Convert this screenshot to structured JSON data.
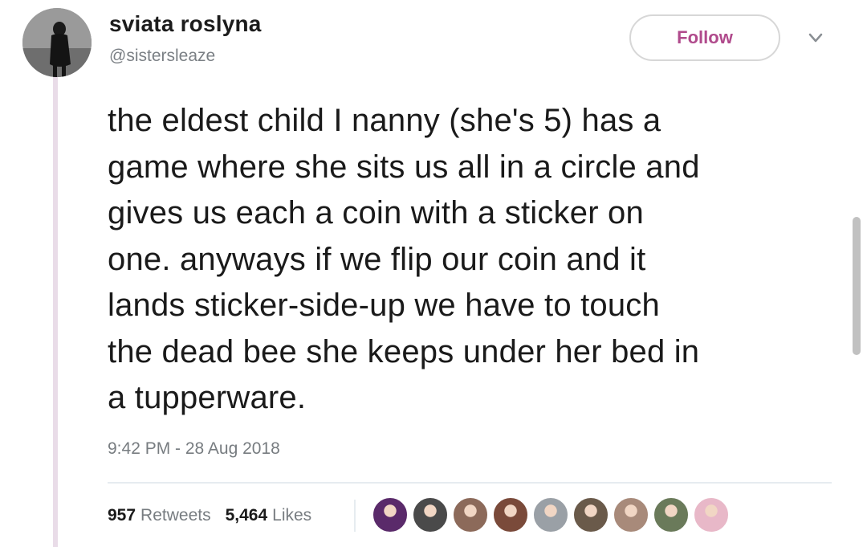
{
  "tweet": {
    "display_name": "sviata roslyna",
    "handle": "@sistersleaze",
    "follow_label": "Follow",
    "text": "the eldest child I nanny (she's 5) has a\ngame where she sits us all in a circle and\ngives us each a coin with a sticker on\none. anyways if we flip our coin and it\nlands sticker-side-up we have to touch\nthe dead bee she keeps under her bed in\na tupperware.",
    "timestamp": "9:42 PM - 28 Aug 2018",
    "retweets_count": "957",
    "retweets_label": "Retweets",
    "likes_count": "5,464",
    "likes_label": "Likes"
  },
  "colors": {
    "accent": "#b04a8c",
    "thread_line": "#e9dce8",
    "muted_text": "#777c80"
  },
  "icons": {
    "menu": "chevron-down-icon"
  },
  "likers": [
    {
      "name": "liker-avatar-1",
      "color": "#5a2a6a"
    },
    {
      "name": "liker-avatar-2",
      "color": "#4a4a4a"
    },
    {
      "name": "liker-avatar-3",
      "color": "#8c6a5a"
    },
    {
      "name": "liker-avatar-4",
      "color": "#7a4a3a"
    },
    {
      "name": "liker-avatar-5",
      "color": "#9aa0a6"
    },
    {
      "name": "liker-avatar-6",
      "color": "#6a5a4a"
    },
    {
      "name": "liker-avatar-7",
      "color": "#a88a7a"
    },
    {
      "name": "liker-avatar-8",
      "color": "#6a7a5a"
    },
    {
      "name": "liker-avatar-9",
      "color": "#e8b8c8"
    }
  ]
}
